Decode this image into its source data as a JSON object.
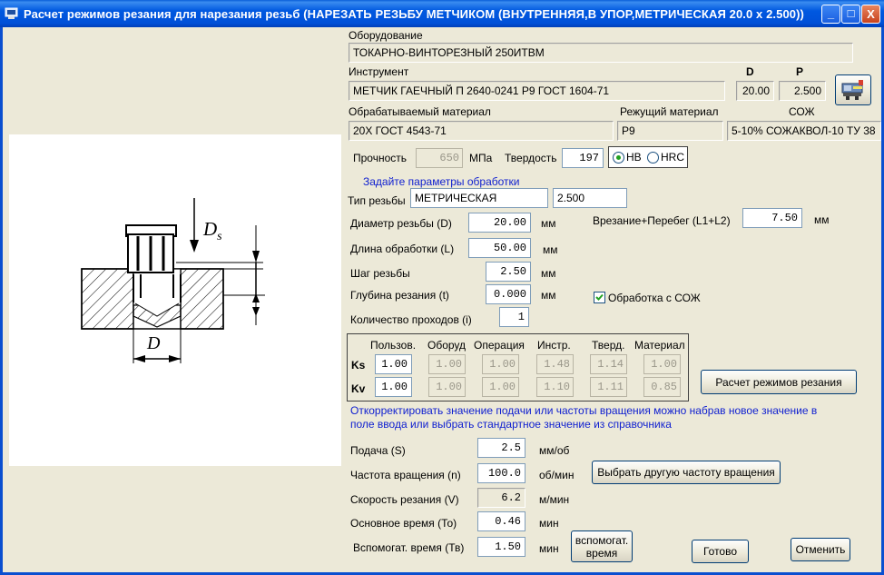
{
  "window": {
    "title": "Расчет режимов резания для нарезания резьб (НАРЕЗАТЬ РЕЗЬБУ МЕТЧИКОМ (ВНУТРЕННЯЯ,В УПОР,МЕТРИЧЕСКАЯ 20.0 x 2.500))",
    "minimize": "_",
    "maximize": "□",
    "close": "X"
  },
  "equipment": {
    "label": "Оборудование",
    "value": "ТОКАРНО-ВИНТОРЕЗНЫЙ 250ИТВМ"
  },
  "tool": {
    "label": "Инструмент",
    "value": "МЕТЧИК ГАЕЧНЫЙ П 2640-0241 Р9 ГОСТ 1604-71",
    "d_label": "D",
    "d_value": "20.00",
    "p_label": "P",
    "p_value": "2.500"
  },
  "material": {
    "label": "Обрабатываемый материал",
    "value": "20Х ГОСТ 4543-71"
  },
  "cutting_material": {
    "label": "Режущий материал",
    "value": "Р9"
  },
  "coolant": {
    "label": "СОЖ",
    "value": "5-10% СОЖАКВОЛ-10 ТУ 38"
  },
  "strength": {
    "label": "Прочность",
    "value": "650",
    "unit": "МПа"
  },
  "hardness": {
    "label": "Твердость",
    "value": "197",
    "hb": "HB",
    "hrc": "HRC",
    "selected": "HB"
  },
  "params_hint": "Задайте параметры обработки",
  "thread_type": {
    "label": "Тип резьбы",
    "value": "МЕТРИЧЕСКАЯ",
    "pitch": "2.500"
  },
  "diameter": {
    "label": "Диаметр резьбы (D)",
    "value": "20.00",
    "unit": "мм"
  },
  "length": {
    "label": "Длина обработки (L)",
    "value": "50.00",
    "unit": "мм"
  },
  "pitch": {
    "label": "Шаг резьбы",
    "value": "2.50",
    "unit": "мм"
  },
  "depth": {
    "label": "Глубина резания (t)",
    "value": "0.000",
    "unit": "мм"
  },
  "passes": {
    "label": "Количество проходов (i)",
    "value": "1"
  },
  "overrun": {
    "label": "Врезание+Перебег (L1+L2)",
    "value": "7.50",
    "unit": "мм"
  },
  "coolant_check": {
    "label": "Обработка с СОЖ",
    "checked": true
  },
  "coef_table": {
    "headers": [
      "Пользов.",
      "Оборуд",
      "Операция",
      "Инстр.",
      "Тверд.",
      "Материал"
    ],
    "rows": [
      {
        "name": "Ks",
        "values": [
          "1.00",
          "1.00",
          "1.00",
          "1.48",
          "1.14",
          "1.00"
        ]
      },
      {
        "name": "Kv",
        "values": [
          "1.00",
          "1.00",
          "1.00",
          "1.10",
          "1.11",
          "0.85"
        ]
      }
    ]
  },
  "calc_button": "Расчет режимов резания",
  "correct_hint": "Откорректировать значение подачи или частоты вращения можно набрав новое значение в поле ввода или выбрать стандартное значение из справочника",
  "feed": {
    "label": "Подача (S)",
    "value": "2.5",
    "unit": "мм/об"
  },
  "rpm": {
    "label": "Частота вращения (n)",
    "value": "100.0",
    "unit": "об/мин"
  },
  "rpm_button": "Выбрать другую частоту вращения",
  "speed": {
    "label": "Скорость резания (V)",
    "value": "6.2",
    "unit": "м/мин"
  },
  "main_time": {
    "label": "Основное время (То)",
    "value": "0.46",
    "unit": "мин"
  },
  "aux_time": {
    "label": "Вспомогат. время (Тв)",
    "value": "1.50",
    "unit": "мин"
  },
  "aux_button": "вспомогат. время",
  "ok_button": "Готово",
  "cancel_button": "Отменить",
  "figure": {
    "ds_label": "D",
    "ds_sub": "s",
    "d_label": "D"
  }
}
